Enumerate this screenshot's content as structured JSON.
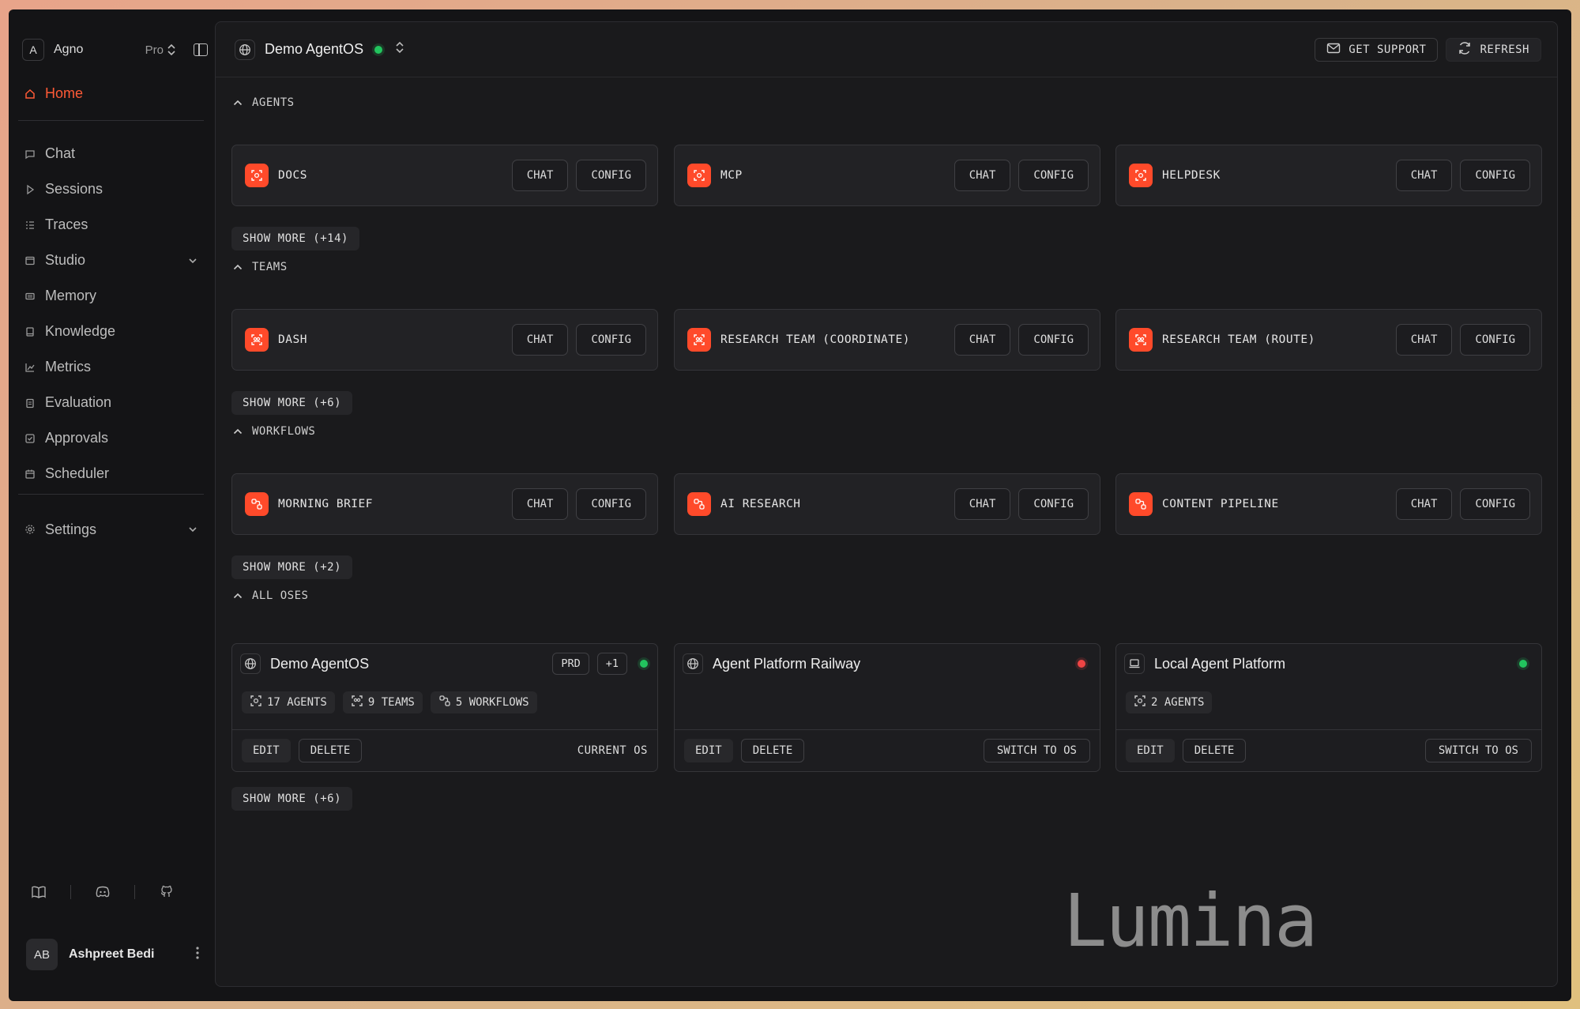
{
  "sidebar": {
    "org_initial": "A",
    "org_name": "Agno",
    "plan": "Pro",
    "home_label": "Home",
    "items": [
      {
        "label": "Chat",
        "icon": "chat-icon"
      },
      {
        "label": "Sessions",
        "icon": "play-icon"
      },
      {
        "label": "Traces",
        "icon": "list-icon"
      },
      {
        "label": "Studio",
        "icon": "window-icon"
      },
      {
        "label": "Memory",
        "icon": "memory-icon"
      },
      {
        "label": "Knowledge",
        "icon": "book-icon"
      },
      {
        "label": "Metrics",
        "icon": "chart-icon"
      },
      {
        "label": "Evaluation",
        "icon": "clipboard-icon"
      },
      {
        "label": "Approvals",
        "icon": "check-square-icon"
      },
      {
        "label": "Scheduler",
        "icon": "calendar-icon"
      }
    ],
    "settings_label": "Settings",
    "user_initials": "AB",
    "user_name": "Ashpreet Bedi"
  },
  "topbar": {
    "os_name": "Demo AgentOS",
    "get_support": "GET SUPPORT",
    "refresh": "REFRESH"
  },
  "sections": {
    "agents": {
      "title": "AGENTS",
      "cards": [
        {
          "name": "DOCS"
        },
        {
          "name": "MCP"
        },
        {
          "name": "HELPDESK"
        }
      ],
      "show_more": "SHOW MORE (+14)"
    },
    "teams": {
      "title": "TEAMS",
      "cards": [
        {
          "name": "DASH"
        },
        {
          "name": "RESEARCH TEAM (COORDINATE)"
        },
        {
          "name": "RESEARCH TEAM (ROUTE)"
        }
      ],
      "show_more": "SHOW MORE (+6)"
    },
    "workflows": {
      "title": "WORKFLOWS",
      "cards": [
        {
          "name": "MORNING BRIEF"
        },
        {
          "name": "AI RESEARCH"
        },
        {
          "name": "CONTENT PIPELINE"
        }
      ],
      "show_more": "SHOW MORE (+2)"
    },
    "oses": {
      "title": "ALL OSES",
      "show_more": "SHOW MORE (+6)",
      "cards": [
        {
          "name": "Demo AgentOS",
          "env_tag": "PRD",
          "extra_tag": "+1",
          "status": "green",
          "agents": "17 AGENTS",
          "teams": "9 TEAMS",
          "workflows": "5 WORKFLOWS",
          "footer": "CURRENT OS"
        },
        {
          "name": "Agent Platform Railway",
          "status": "red",
          "footer": "SWITCH TO OS"
        },
        {
          "name": "Local Agent Platform",
          "status": "green",
          "agents": "2 AGENTS",
          "footer": "SWITCH TO OS"
        }
      ]
    }
  },
  "labels": {
    "chat": "CHAT",
    "config": "CONFIG",
    "edit": "EDIT",
    "delete": "DELETE"
  },
  "watermark": "Lumina",
  "colors": {
    "accent": "#ff4a2a",
    "home_active": "#ff5a36",
    "status_green": "#22c55e",
    "status_red": "#ef4444"
  }
}
